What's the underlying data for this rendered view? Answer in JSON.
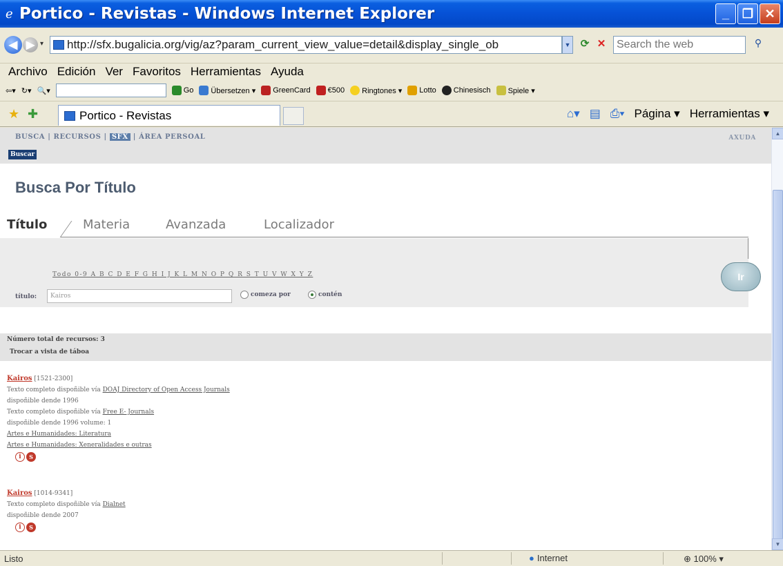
{
  "window": {
    "title": "Portico - Revistas - Windows Internet Explorer"
  },
  "address": {
    "url": "http://sfx.bugalicia.org/vig/az?param_current_view_value=detail&display_single_ob",
    "search_placeholder": "Search the web"
  },
  "menu": [
    "Archivo",
    "Edición",
    "Ver",
    "Favoritos",
    "Herramientas",
    "Ayuda"
  ],
  "links_toolbar": [
    "Go",
    "Übersetzen ▾",
    "GreenCard",
    "€500",
    "Ringtones ▾",
    "Lotto",
    "Chinesisch",
    "Spiele ▾"
  ],
  "tab": {
    "label": "Portico - Revistas"
  },
  "commands": {
    "page": "Página ▾",
    "tools": "Herramientas ▾"
  },
  "site": {
    "nav": {
      "busca": "BUSCA",
      "recursos": "RECURSOS",
      "sfx": "SFX",
      "area": "ÁREA PERSOAL",
      "help": "AXUDA"
    },
    "buscar_button": "Buscar",
    "page_title": "Busca Por Título",
    "tabs": [
      "Título",
      "Materia",
      "Avanzada",
      "Localizador"
    ],
    "alphabet": "Todo 0-9 A B C D E F G H I J K L M N O P Q R S T U V W X Y Z",
    "title_label": "título:",
    "title_value": "Kairos",
    "radio_starts": "comeza por",
    "radio_contains": "contén",
    "go_button": "Ir",
    "results": {
      "total": "Número total de recursos: 3",
      "switch_view": "Trocar a vista de táboa"
    },
    "entries": [
      {
        "title": "Kairos",
        "issn": "[1521-2300]",
        "lines": [
          {
            "pre": "Texto completo dispoñible vía ",
            "link": "DOAJ Directory of Open Access Journals"
          },
          {
            "pre": "dispoñible dende 1996",
            "link": ""
          },
          {
            "pre": "Texto completo dispoñible vía ",
            "link": "Free E- Journals"
          },
          {
            "pre": "dispoñible dende 1996 volume: 1",
            "link": ""
          },
          {
            "pre": "",
            "link": "Artes e Humanidades: Literatura"
          },
          {
            "pre": "",
            "link": "Artes e Humanidades: Xeneralidades e outras"
          }
        ]
      },
      {
        "title": "Kairos",
        "issn": "[1014-9341]",
        "lines": [
          {
            "pre": "Texto completo dispoñible vía ",
            "link": "Dialnet"
          },
          {
            "pre": "dispoñible dende 2007",
            "link": ""
          }
        ]
      }
    ]
  },
  "status": {
    "text": "Listo",
    "zone": "Internet",
    "zoom": "100%"
  }
}
